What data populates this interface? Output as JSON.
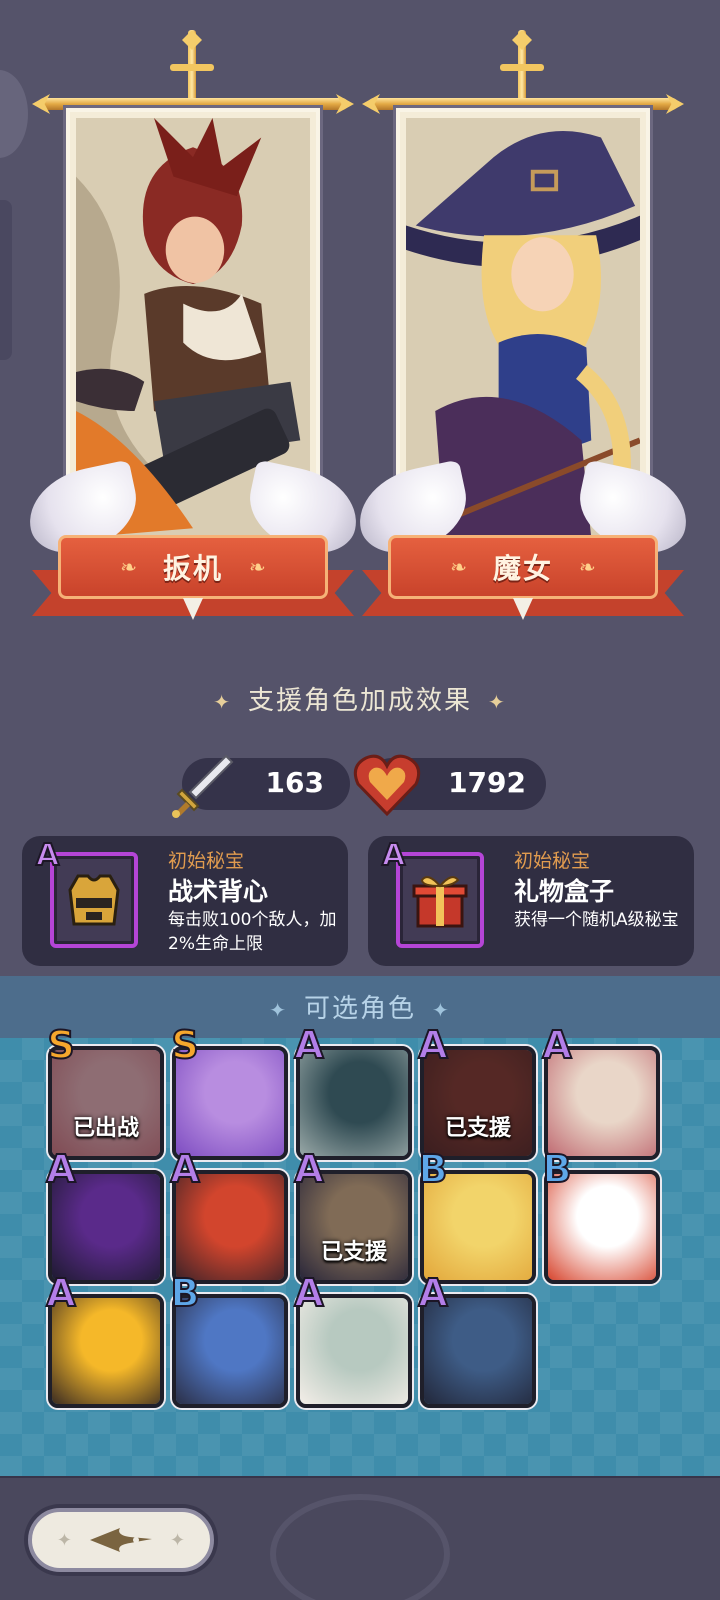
{
  "support_heroes": [
    {
      "name": "扳机",
      "flourish_left": "❧",
      "flourish_right": "❧"
    },
    {
      "name": "魔女",
      "flourish_left": "❧",
      "flourish_right": "❧"
    }
  ],
  "bonus_section": {
    "title": "支援角色加成效果",
    "flourish": "✦"
  },
  "stats": {
    "attack": "163",
    "health": "1792"
  },
  "relics": [
    {
      "grade": "A",
      "type": "初始秘宝",
      "name": "战术背心",
      "desc": "每击败100个敌人，加2%生命上限",
      "icon": "vest-icon"
    },
    {
      "grade": "A",
      "type": "初始秘宝",
      "name": "礼物盒子",
      "desc": "获得一个随机A级秘宝",
      "icon": "gift-box-icon"
    }
  ],
  "roster": {
    "title": "可选角色",
    "heroes": [
      {
        "grade": "S",
        "status": "已出战",
        "palette": [
          "#f3b7b9",
          "#d9787f"
        ]
      },
      {
        "grade": "S",
        "status": "",
        "palette": [
          "#b88de0",
          "#7d4cc1"
        ]
      },
      {
        "grade": "A",
        "status": "",
        "palette": [
          "#2f4a52",
          "#9aa9a8"
        ]
      },
      {
        "grade": "A",
        "status": "已支援",
        "palette": [
          "#8a3a2a",
          "#5a2620"
        ]
      },
      {
        "grade": "A",
        "status": "",
        "palette": [
          "#e9d6c8",
          "#c06a72"
        ]
      },
      {
        "grade": "A",
        "status": "",
        "palette": [
          "#5a2a8a",
          "#1e1a30"
        ]
      },
      {
        "grade": "A",
        "status": "",
        "palette": [
          "#d2452d",
          "#3c2228"
        ]
      },
      {
        "grade": "A",
        "status": "已支援",
        "palette": [
          "#d9b383",
          "#3a3550"
        ]
      },
      {
        "grade": "B",
        "status": "",
        "palette": [
          "#f2d46a",
          "#e2a63a"
        ]
      },
      {
        "grade": "B",
        "status": "",
        "palette": [
          "#ffffff",
          "#d7452e"
        ]
      },
      {
        "grade": "A",
        "status": "",
        "palette": [
          "#f5b829",
          "#3a2b22"
        ]
      },
      {
        "grade": "B",
        "status": "",
        "palette": [
          "#4f77c4",
          "#2b2f47"
        ]
      },
      {
        "grade": "A",
        "status": "",
        "palette": [
          "#b7c9c0",
          "#f4eee8"
        ]
      },
      {
        "grade": "A",
        "status": "",
        "palette": [
          "#3e5c86",
          "#22273a"
        ]
      }
    ]
  },
  "footer": {
    "back_icon": "back-arrow-icon"
  },
  "colors": {
    "background": "#55536a",
    "roster_bg": "#3f8dab",
    "relic_border": "#b545d7",
    "ribbon": "#d0482f"
  }
}
